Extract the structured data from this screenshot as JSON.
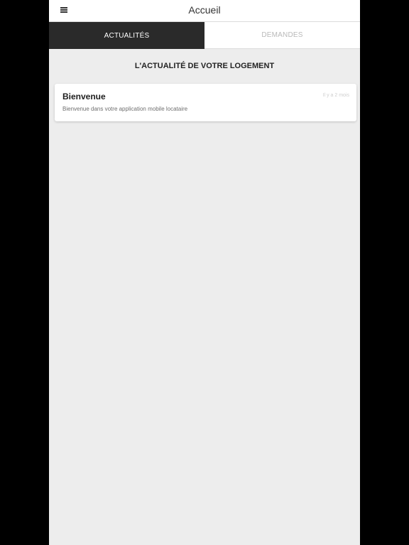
{
  "header": {
    "title": "Accueil",
    "menu_icon": "hamburger-menu-icon"
  },
  "tabs": [
    {
      "label": "ACTUALITÉS",
      "active": true
    },
    {
      "label": "DEMANDES",
      "active": false
    }
  ],
  "section": {
    "title": "L'ACTUALITÉ DE VOTRE LOGEMENT"
  },
  "news": [
    {
      "title": "Bienvenue",
      "time": "Il y a 2 mois",
      "body": "Bienvenue dans votre application mobile locataire"
    }
  ],
  "colors": {
    "active_tab_bg": "#2a2a2a",
    "page_bg": "#ededed",
    "outer_bg": "#000000"
  }
}
